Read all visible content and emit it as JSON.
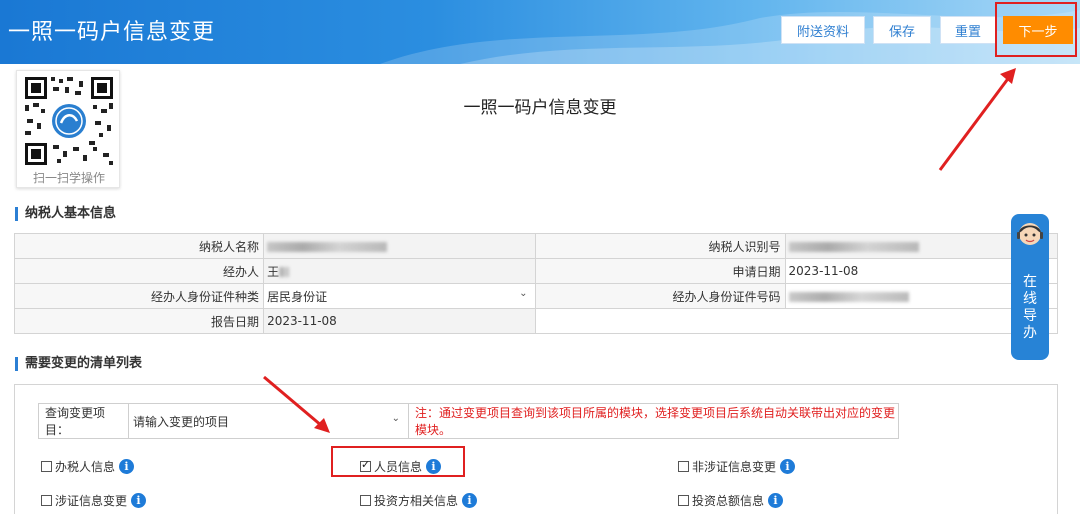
{
  "header": {
    "title": "一照一码户信息变更",
    "buttons": {
      "attach": "附送资料",
      "save": "保存",
      "reset": "重置",
      "next": "下一步"
    }
  },
  "qr": {
    "caption": "扫一扫学操作"
  },
  "page_title": "一照一码户信息变更",
  "basic_info": {
    "section_title": "纳税人基本信息",
    "rows": [
      {
        "l1": "纳税人名称",
        "l2": "纳税人识别号"
      },
      {
        "l1": "经办人",
        "v1": "王",
        "l2": "申请日期",
        "v2": "2023-11-08"
      },
      {
        "l1": "经办人身份证件种类",
        "v1": "居民身份证",
        "l2": "经办人身份证件号码"
      },
      {
        "l1": "报告日期",
        "v1": "2023-11-08"
      }
    ]
  },
  "guide": {
    "text": [
      "在",
      "线",
      "导",
      "办"
    ]
  },
  "change_list": {
    "section_title": "需要变更的清单列表",
    "query_label": "查询变更项目：",
    "query_placeholder": "请输入变更的项目",
    "note": "注：通过变更项目查询到该项目所属的模块，选择变更项目后系统自动关联带出对应的变更模块。",
    "items": [
      {
        "label": "办税人信息",
        "checked": false
      },
      {
        "label": "人员信息",
        "checked": true
      },
      {
        "label": "非涉证信息变更",
        "checked": false
      },
      {
        "label": "涉证信息变更",
        "checked": false
      },
      {
        "label": "投资方相关信息",
        "checked": false
      },
      {
        "label": "投资总额信息",
        "checked": false
      }
    ]
  },
  "colors": {
    "header": "#1a78d4",
    "next_button": "#ff8c00",
    "highlight": "#e02020",
    "info_icon": "#1e7bd8"
  }
}
